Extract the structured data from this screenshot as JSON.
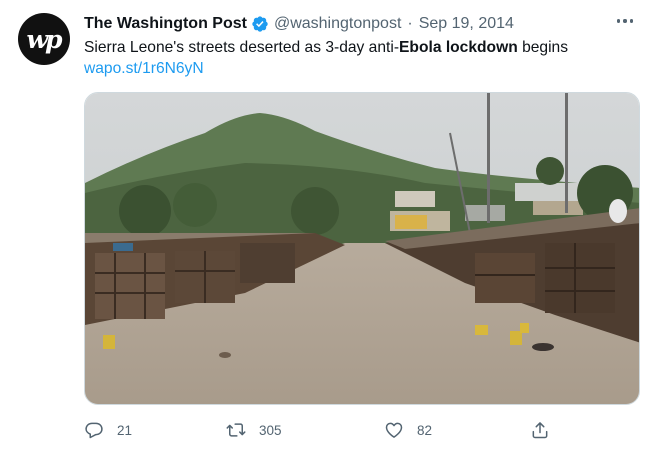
{
  "tweet": {
    "avatar_text": "wp",
    "author": "The Washington Post",
    "handle": "@washingtonpost",
    "separator": "·",
    "date": "Sep 19, 2014",
    "text_prefix": "Sierra Leone's streets deserted as 3-day anti-",
    "text_bold": "Ebola lockdown",
    "text_suffix": " begins",
    "link": "wapo.st/1r6N6yN"
  },
  "actions": {
    "replies": "21",
    "retweets": "305",
    "likes": "82"
  },
  "icons": {
    "verified": "verified-badge-icon",
    "more": "more-options-icon",
    "reply": "reply-icon",
    "retweet": "retweet-icon",
    "like": "heart-icon",
    "share": "share-icon"
  },
  "colors": {
    "link": "#1d9bf0",
    "verified": "#1d9bf0",
    "muted": "#536471",
    "text": "#0f1419"
  }
}
